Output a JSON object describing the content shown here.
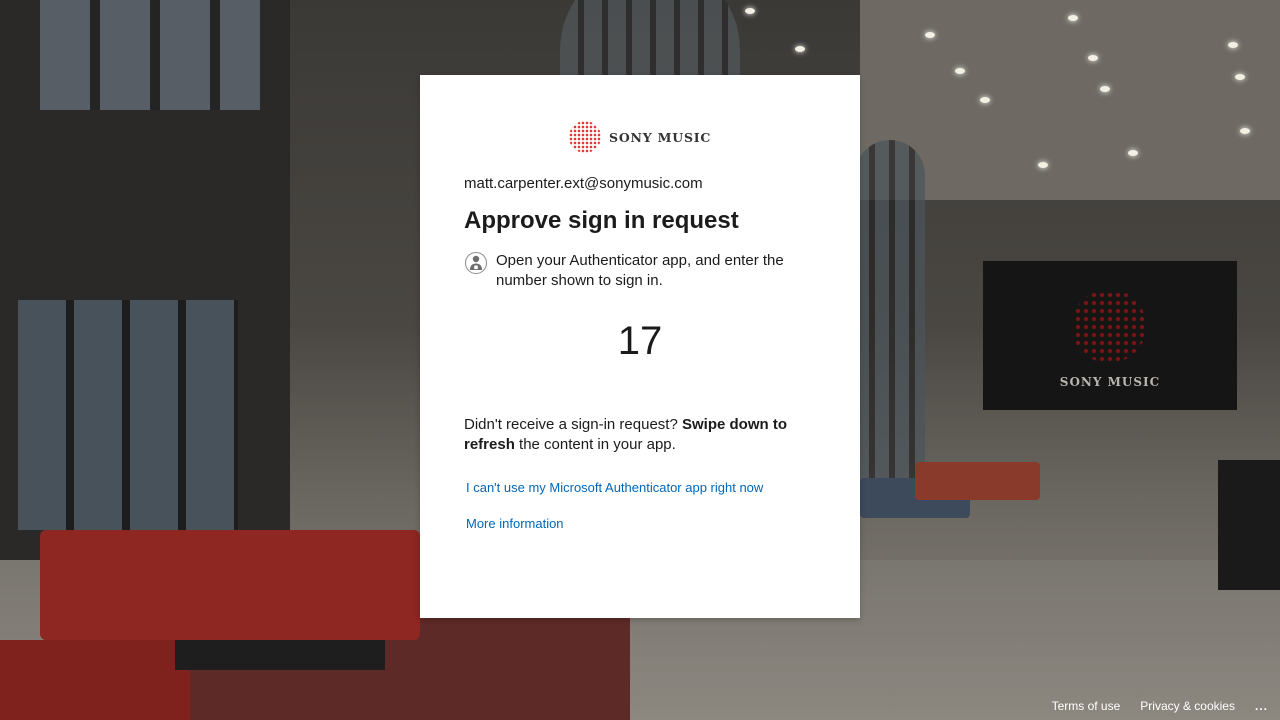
{
  "brand": {
    "logo_text": "SONY MUSIC",
    "logo_color": "#e0363e"
  },
  "background": {
    "screen_label": "SONY MUSIC"
  },
  "signin": {
    "identity": "matt.carpenter.ext@sonymusic.com",
    "title": "Approve sign in request",
    "instruction": "Open your Authenticator app, and enter the number shown to sign in.",
    "instruction_icon": "authenticator-icon",
    "number": "17",
    "notice_prefix": "Didn't receive a sign-in request? ",
    "notice_bold": "Swipe down to refresh",
    "notice_suffix": " the content in your app.",
    "link_cant_use": "I can't use my Microsoft Authenticator app right now",
    "link_more_info": "More information",
    "link_color": "#0067b8"
  },
  "footer": {
    "terms": "Terms of use",
    "privacy": "Privacy & cookies",
    "more": "..."
  }
}
